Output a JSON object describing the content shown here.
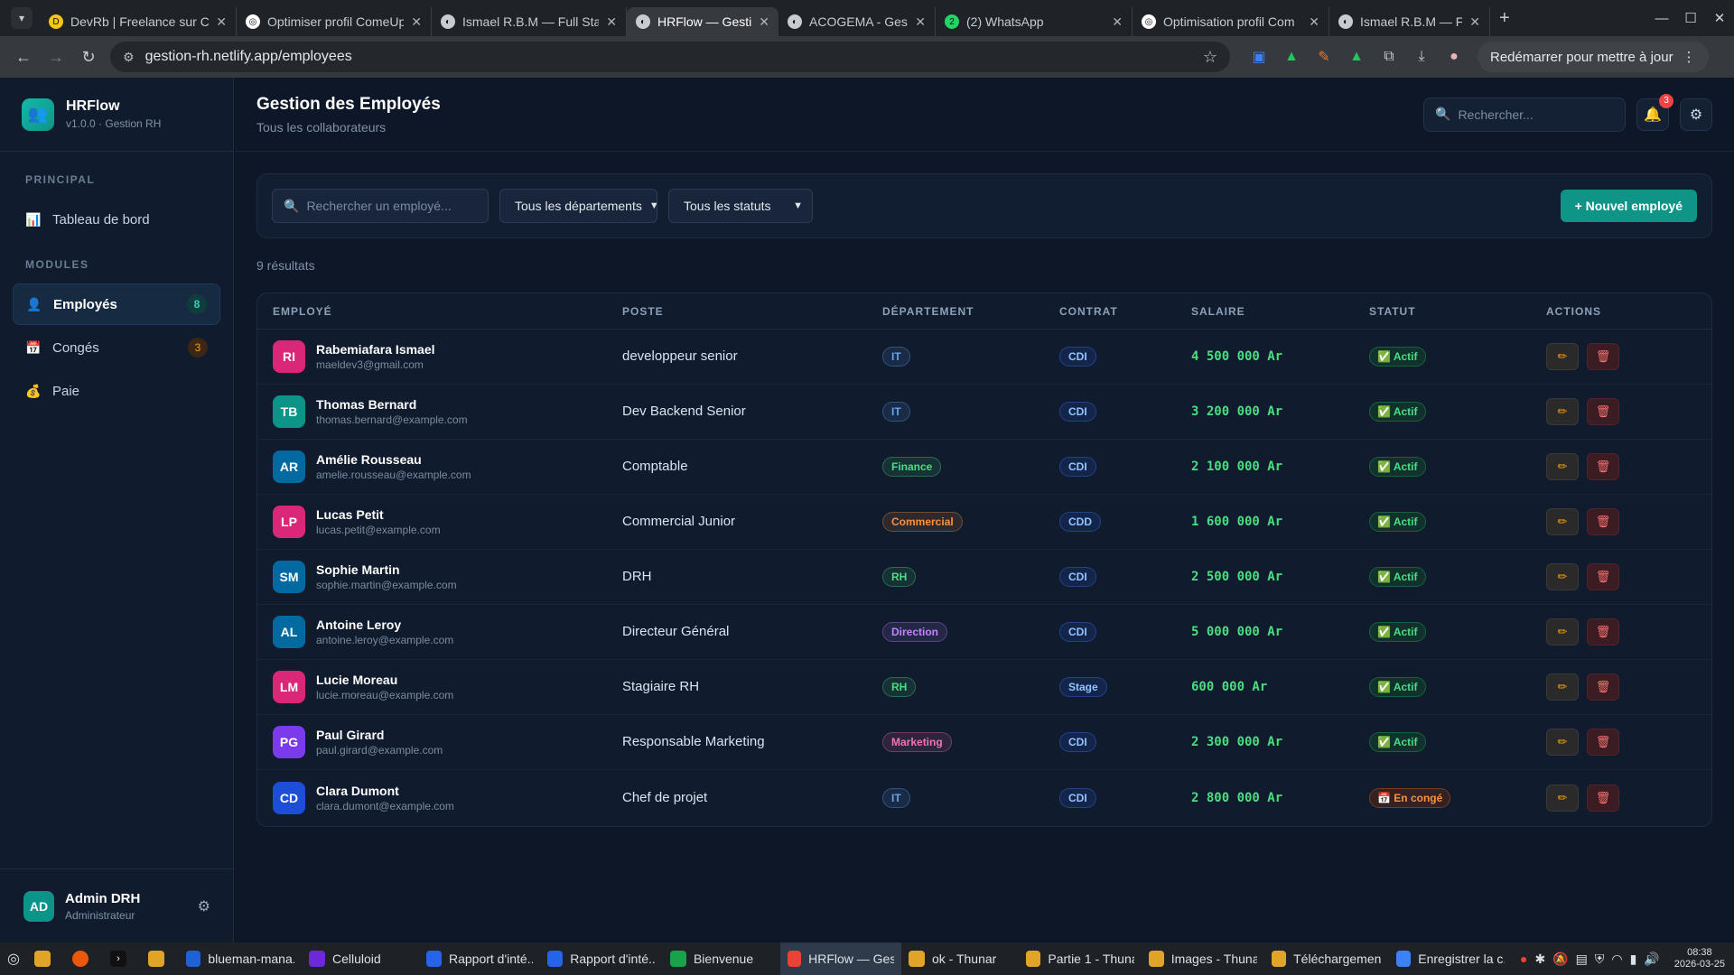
{
  "browser": {
    "tabs": [
      {
        "title": "DevRb | Freelance sur Co",
        "color": "#f5c518",
        "glyph": "D"
      },
      {
        "title": "Optimiser profil ComeUp",
        "color": "#ffffff",
        "glyph": "◎"
      },
      {
        "title": "Ismael R.B.M — Full Stac",
        "color": "#c8ccd0",
        "glyph": "◐"
      },
      {
        "title": "HRFlow — Gestion RH",
        "color": "#c8ccd0",
        "glyph": "◐",
        "active": true
      },
      {
        "title": "ACOGEMA - Gestion de l",
        "color": "#c8ccd0",
        "glyph": "◐"
      },
      {
        "title": "(2) WhatsApp",
        "color": "#25d366",
        "glyph": "2"
      },
      {
        "title": "Optimisation profil Com",
        "color": "#ffffff",
        "glyph": "◎"
      },
      {
        "title": "Ismael R.B.M — Full Stac",
        "color": "#c8ccd0",
        "glyph": "◐"
      }
    ],
    "url": "gestion-rh.netlify.app/employees",
    "restart_label": "Redémarrer pour mettre à jour"
  },
  "sidebar": {
    "brand": "HRFlow",
    "version": "v1.0.0 · Gestion RH",
    "section_principal": "PRINCIPAL",
    "section_modules": "MODULES",
    "dashboard": "Tableau de bord",
    "items": [
      {
        "label": "Employés",
        "badge": "8",
        "icon": "👤",
        "active": true,
        "badge_style": "teal"
      },
      {
        "label": "Congés",
        "badge": "3",
        "icon": "📅",
        "active": false,
        "badge_style": "orange"
      },
      {
        "label": "Paie",
        "badge": "",
        "icon": "💰",
        "active": false
      }
    ],
    "user": {
      "initials": "AD",
      "name": "Admin DRH",
      "role": "Administrateur"
    }
  },
  "header": {
    "title": "Gestion des Employés",
    "subtitle": "Tous les collaborateurs",
    "search_placeholder": "Rechercher...",
    "notif_count": "3"
  },
  "filters": {
    "search_placeholder": "Rechercher un employé...",
    "department": "Tous les départements",
    "status": "Tous les statuts",
    "add_label": "+ Nouvel employé"
  },
  "results": "9 résultats",
  "table": {
    "columns": [
      "EMPLOYÉ",
      "POSTE",
      "DÉPARTEMENT",
      "CONTRAT",
      "SALAIRE",
      "STATUT",
      "ACTIONS"
    ],
    "rows": [
      {
        "initials": "RI",
        "name": "Rabemiafara Ismael",
        "email": "maeldev3@gmail.com",
        "poste": "developpeur senior",
        "dept": "IT",
        "contrat": "CDI",
        "salaire": "4 500 000 Ar",
        "statut": "✅ Actif",
        "avatar": "#db2777"
      },
      {
        "initials": "TB",
        "name": "Thomas Bernard",
        "email": "thomas.bernard@example.com",
        "poste": "Dev Backend Senior",
        "dept": "IT",
        "contrat": "CDI",
        "salaire": "3 200 000 Ar",
        "statut": "✅ Actif",
        "avatar": "#0d9488"
      },
      {
        "initials": "AR",
        "name": "Amélie Rousseau",
        "email": "amelie.rousseau@example.com",
        "poste": "Comptable",
        "dept": "Finance",
        "contrat": "CDI",
        "salaire": "2 100 000 Ar",
        "statut": "✅ Actif",
        "avatar": "#0369a1"
      },
      {
        "initials": "LP",
        "name": "Lucas Petit",
        "email": "lucas.petit@example.com",
        "poste": "Commercial Junior",
        "dept": "Commercial",
        "contrat": "CDD",
        "salaire": "1 600 000 Ar",
        "statut": "✅ Actif",
        "avatar": "#db2777"
      },
      {
        "initials": "SM",
        "name": "Sophie Martin",
        "email": "sophie.martin@example.com",
        "poste": "DRH",
        "dept": "RH",
        "contrat": "CDI",
        "salaire": "2 500 000 Ar",
        "statut": "✅ Actif",
        "avatar": "#0369a1"
      },
      {
        "initials": "AL",
        "name": "Antoine Leroy",
        "email": "antoine.leroy@example.com",
        "poste": "Directeur Général",
        "dept": "Direction",
        "contrat": "CDI",
        "salaire": "5 000 000 Ar",
        "statut": "✅ Actif",
        "avatar": "#0369a1"
      },
      {
        "initials": "LM",
        "name": "Lucie Moreau",
        "email": "lucie.moreau@example.com",
        "poste": "Stagiaire RH",
        "dept": "RH",
        "contrat": "Stage",
        "salaire": "600 000 Ar",
        "statut": "✅ Actif",
        "avatar": "#db2777"
      },
      {
        "initials": "PG",
        "name": "Paul Girard",
        "email": "paul.girard@example.com",
        "poste": "Responsable Marketing",
        "dept": "Marketing",
        "contrat": "CDI",
        "salaire": "2 300 000 Ar",
        "statut": "✅ Actif",
        "avatar": "#7c3aed"
      },
      {
        "initials": "CD",
        "name": "Clara Dumont",
        "email": "clara.dumont@example.com",
        "poste": "Chef de projet",
        "dept": "IT",
        "contrat": "CDI",
        "salaire": "2 800 000 Ar",
        "statut": "📅 En congé",
        "avatar": "#1d4ed8"
      }
    ]
  },
  "dept_colors": {
    "IT": "#60a5fa",
    "Finance": "#4ade80",
    "Commercial": "#fb923c",
    "RH": "#4ade80",
    "Direction": "#c084fc",
    "Marketing": "#f472b6"
  },
  "taskbar": {
    "items": [
      {
        "label": "blueman-mana...",
        "color": "#1e63d6"
      },
      {
        "label": "Celluloid",
        "color": "#6d28d9"
      },
      {
        "label": "Rapport d'inté...",
        "color": "#2563eb"
      },
      {
        "label": "Rapport d'inté...",
        "color": "#2563eb"
      },
      {
        "label": "Bienvenue",
        "color": "#16a34a"
      },
      {
        "label": "HRFlow — Gest...",
        "color": "#ea4335",
        "active": true
      },
      {
        "label": "ok - Thunar",
        "color": "#e0a526"
      },
      {
        "label": "Partie 1 - Thunar",
        "color": "#e0a526"
      },
      {
        "label": "Images - Thunar",
        "color": "#e0a526"
      },
      {
        "label": "Téléchargemen...",
        "color": "#e0a526"
      },
      {
        "label": "Enregistrer la c...",
        "color": "#3b82f6"
      }
    ],
    "time": "08:38",
    "date": "2026-03-25"
  }
}
